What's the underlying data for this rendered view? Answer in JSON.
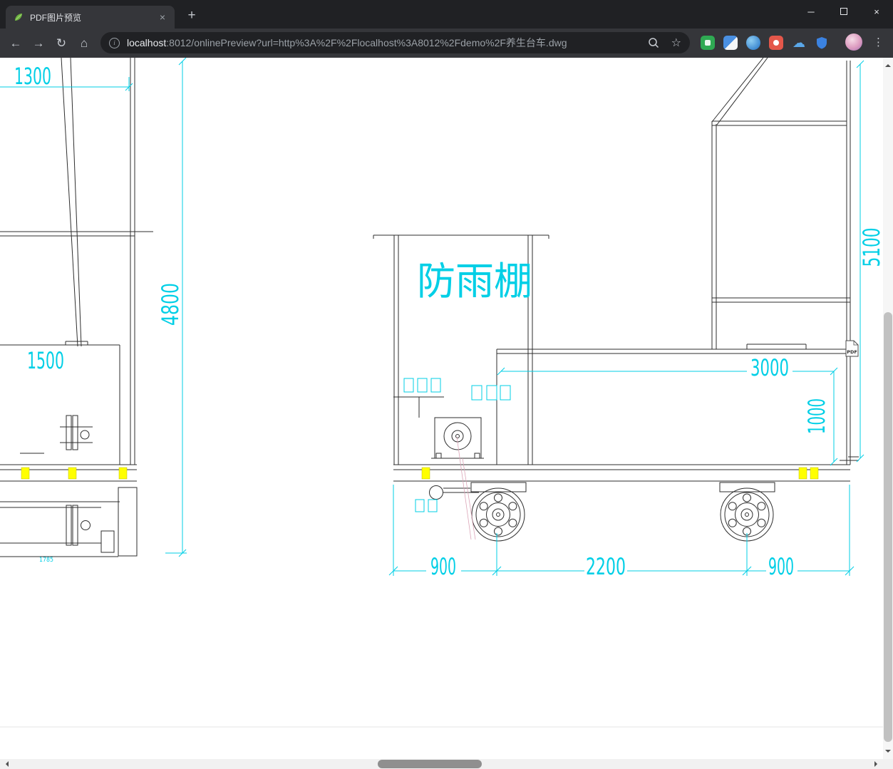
{
  "browser": {
    "tab_title": "PDF图片预览",
    "url_host": "localhost",
    "url_path": ":8012/onlinePreview?url=http%3A%2F%2Flocalhost%3A8012%2Fdemo%2F养生台车.dwg"
  },
  "icons": {
    "back": "←",
    "forward": "→",
    "reload": "↻",
    "home": "⌂",
    "info": "i",
    "star": "☆",
    "cloud": "☁",
    "menu": "⋮",
    "minimize": "─",
    "close": "×",
    "plus": "+"
  },
  "drawing": {
    "canopy_label": "防雨棚",
    "pdf_badge": "PDF",
    "dims": {
      "top_left_width": "1300",
      "left_height": "4800",
      "left_inner_width": "1500",
      "left_small": "1785",
      "right_height": "5100",
      "deck_length": "3000",
      "deck_height": "1000",
      "wheelbase_left": "900",
      "wheelbase_center": "2200",
      "wheelbase_right": "900"
    },
    "colors": {
      "dimension_cyan": "#00cfe6",
      "line_dark": "#2e2e2e",
      "highlight_yellow": "#ffff00"
    }
  }
}
